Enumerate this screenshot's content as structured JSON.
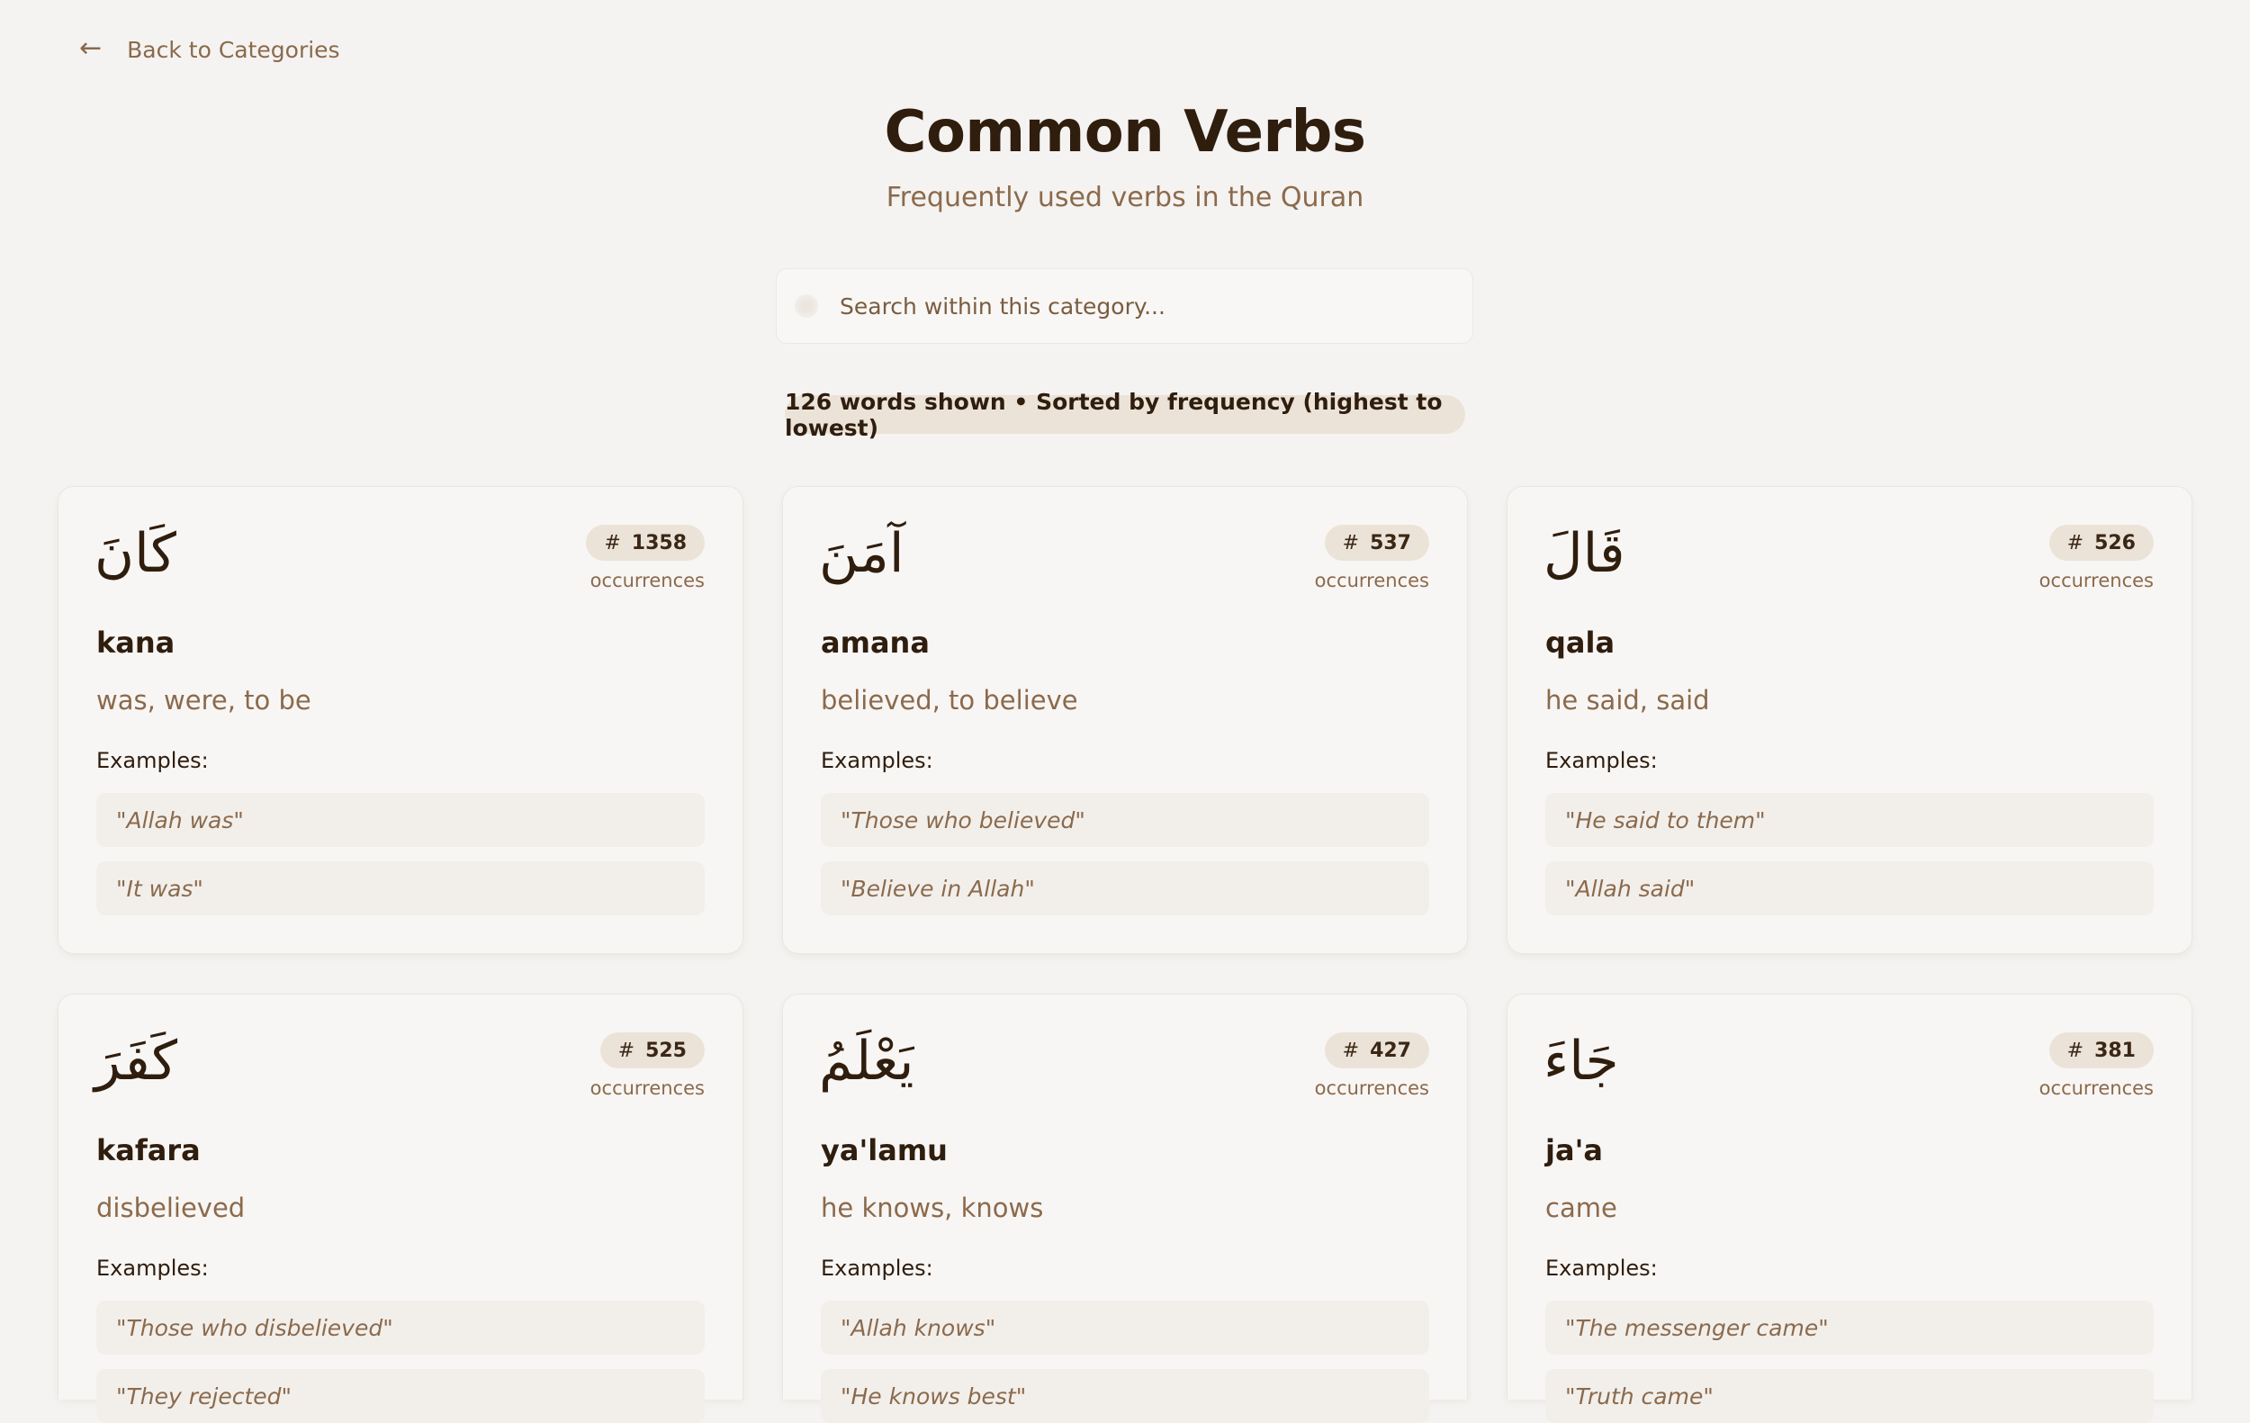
{
  "nav": {
    "back_label": "Back to Categories"
  },
  "header": {
    "title": "Common Verbs",
    "subtitle": "Frequently used verbs in the Quran"
  },
  "search": {
    "placeholder": "Search within this category...",
    "value": ""
  },
  "summary": "126 words shown • Sorted by frequency (highest to lowest)",
  "labels": {
    "occurrences": "occurrences",
    "examples": "Examples:",
    "hash": "#"
  },
  "cards": [
    {
      "arabic": "كَانَ",
      "count": "1358",
      "transliteration": "kana",
      "meaning": "was, were, to be",
      "examples": [
        "\"Allah was\"",
        "\"It was\""
      ]
    },
    {
      "arabic": "آمَنَ",
      "count": "537",
      "transliteration": "amana",
      "meaning": "believed, to believe",
      "examples": [
        "\"Those who believed\"",
        "\"Believe in Allah\""
      ]
    },
    {
      "arabic": "قَالَ",
      "count": "526",
      "transliteration": "qala",
      "meaning": "he said, said",
      "examples": [
        "\"He said to them\"",
        "\"Allah said\""
      ]
    },
    {
      "arabic": "كَفَرَ",
      "count": "525",
      "transliteration": "kafara",
      "meaning": "disbelieved",
      "examples": [
        "\"Those who disbelieved\"",
        "\"They rejected\""
      ]
    },
    {
      "arabic": "يَعْلَمُ",
      "count": "427",
      "transliteration": "ya'lamu",
      "meaning": "he knows, knows",
      "examples": [
        "\"Allah knows\"",
        "\"He knows best\""
      ]
    },
    {
      "arabic": "جَاءَ",
      "count": "381",
      "transliteration": "ja'a",
      "meaning": "came",
      "examples": [
        "\"The messenger came\"",
        "\"Truth came\""
      ]
    }
  ],
  "colors": {
    "background": "#f5f3f1",
    "accent_brown": "#8b6a4c",
    "dark_text": "#2f1d0e",
    "badge_bg": "#ebe3d8"
  }
}
